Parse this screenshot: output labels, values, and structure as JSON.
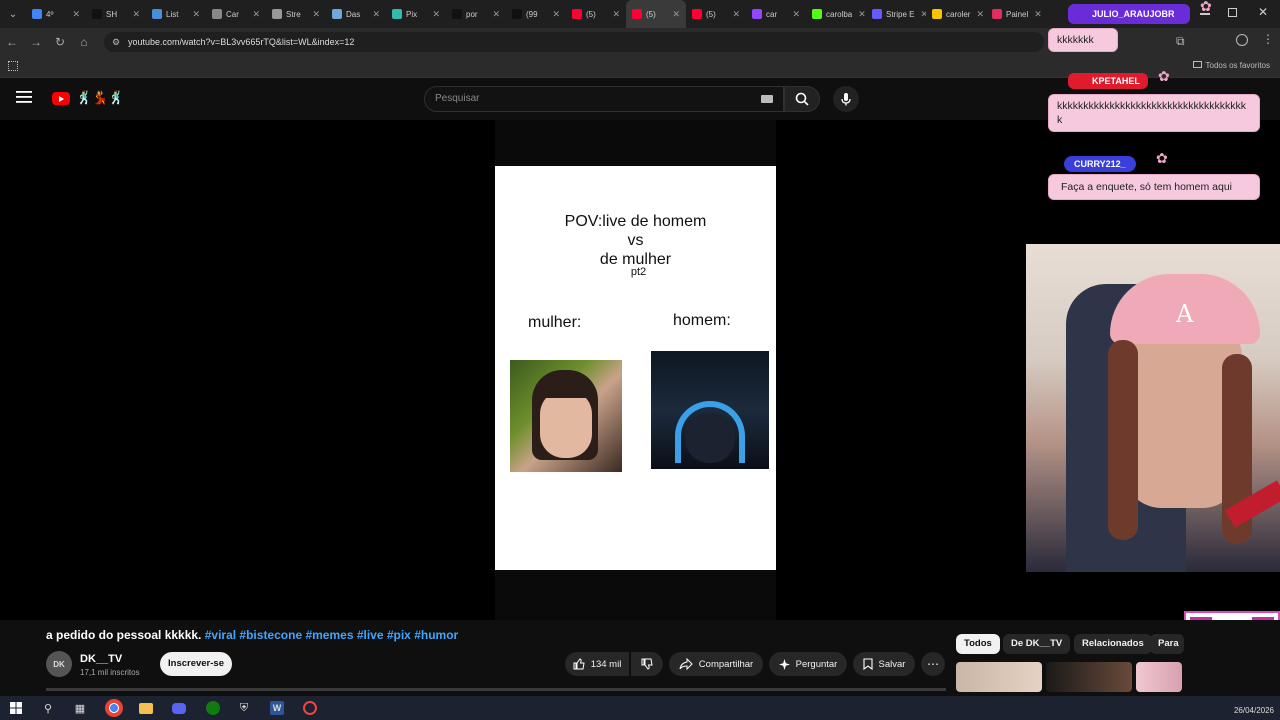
{
  "browser": {
    "tabs": [
      {
        "label": "4º",
        "color": "#4285f4"
      },
      {
        "label": "SH",
        "color": "#111111"
      },
      {
        "label": "List",
        "color": "#4a90d9"
      },
      {
        "label": "Car",
        "color": "#888888"
      },
      {
        "label": "Stre",
        "color": "#999999"
      },
      {
        "label": "Das",
        "color": "#6fa8dc"
      },
      {
        "label": "Pix",
        "color": "#32bcad"
      },
      {
        "label": "por",
        "color": "#111111"
      },
      {
        "label": "(99",
        "color": "#111111"
      },
      {
        "label": "(5)",
        "color": "#ff0033"
      },
      {
        "label": "(5)",
        "color": "#ff0033"
      },
      {
        "label": "(5)",
        "color": "#ff0033"
      },
      {
        "label": "car",
        "color": "#9146ff"
      },
      {
        "label": "carolba",
        "color": "#53fc18"
      },
      {
        "label": "Stripe E",
        "color": "#635bff"
      },
      {
        "label": "caroler",
        "color": "#f7c400"
      },
      {
        "label": "Painel",
        "color": "#e02f5f"
      }
    ],
    "url": "youtube.com/watch?v=BL3vv665rTQ&list=WL&index=12",
    "favorites_label": "Todos os favoritos"
  },
  "youtube": {
    "search_placeholder": "Pesquisar",
    "logo_doodle": "🕺💃🕺"
  },
  "short": {
    "pov_line1": "POV:live de homem",
    "pov_line2": "vs",
    "pov_line3": "de mulher",
    "pt2": "pt2",
    "label_woman": "mulher:",
    "label_man": "homem:"
  },
  "chat": [
    {
      "user": "JULIO_ARAUJOBR",
      "message": "kkkkkkk",
      "name_color": "#7b3ff2"
    },
    {
      "user": "KPETAHEL",
      "message": "kkkkkkkkkkkkkkkkkkkkkkkkkkkkkkkkkkkkk",
      "name_color": "#e01b2e"
    },
    {
      "user": "CURRY212_",
      "message": "Faça a enquete, só tem homem aqui",
      "name_color": "#3b3fd9"
    }
  ],
  "video": {
    "title": "a pedido do pessoal kkkkk.",
    "hashtags": "#viral #bistecone #memes #live #pix #humor",
    "channel_avatar": "DK",
    "channel_name": "DK__TV",
    "subscribers": "17,1 mil inscritos",
    "subscribe_label": "Inscrever-se",
    "likes": "134 mil",
    "share_label": "Compartilhar",
    "ask_label": "Perguntar",
    "save_label": "Salvar"
  },
  "chips": [
    "Todos",
    "De DK__TV",
    "Relacionados",
    "Para"
  ],
  "taskbar": {
    "date": "26/04/2026"
  }
}
